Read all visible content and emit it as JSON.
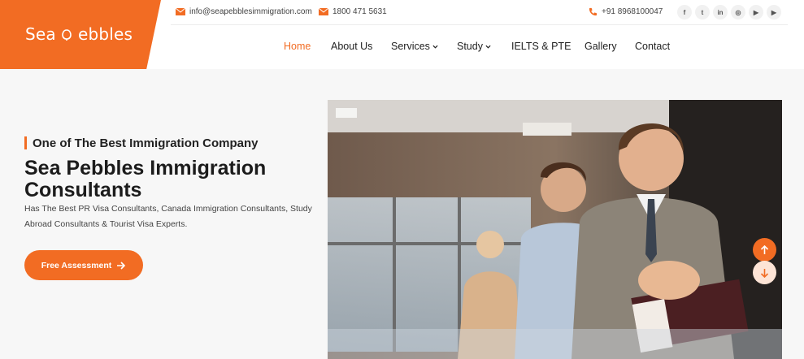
{
  "brand": {
    "logo_text_left": "Sea",
    "logo_text_right": "ebbles",
    "accent_color": "#f26c23"
  },
  "topbar": {
    "email": "info@seapebblesimmigration.com",
    "toll_free": "1800 471 5631",
    "phone": "+91 8968100047",
    "social_icons": [
      {
        "name": "facebook-icon",
        "glyph": "f"
      },
      {
        "name": "twitter-icon",
        "glyph": "t"
      },
      {
        "name": "linkedin-icon",
        "glyph": "in"
      },
      {
        "name": "instagram-icon",
        "glyph": "◎"
      },
      {
        "name": "youtube-icon",
        "glyph": "▶"
      },
      {
        "name": "youtube-icon-2",
        "glyph": "▶"
      }
    ]
  },
  "nav": {
    "home": "Home",
    "about": "About Us",
    "services": "Services",
    "study": "Study",
    "ielts": "IELTS & PTE",
    "gallery": "Gallery",
    "contact": "Contact"
  },
  "hero": {
    "eyebrow": "One of The Best Immigration Company",
    "title": "Sea Pebbles Immigration Consultants",
    "description": "Has The Best PR Visa Consultants, Canada Immigration Consultants, Study Abroad Consultants & Tourist Visa Experts.",
    "cta_label": "Free Assessment"
  }
}
